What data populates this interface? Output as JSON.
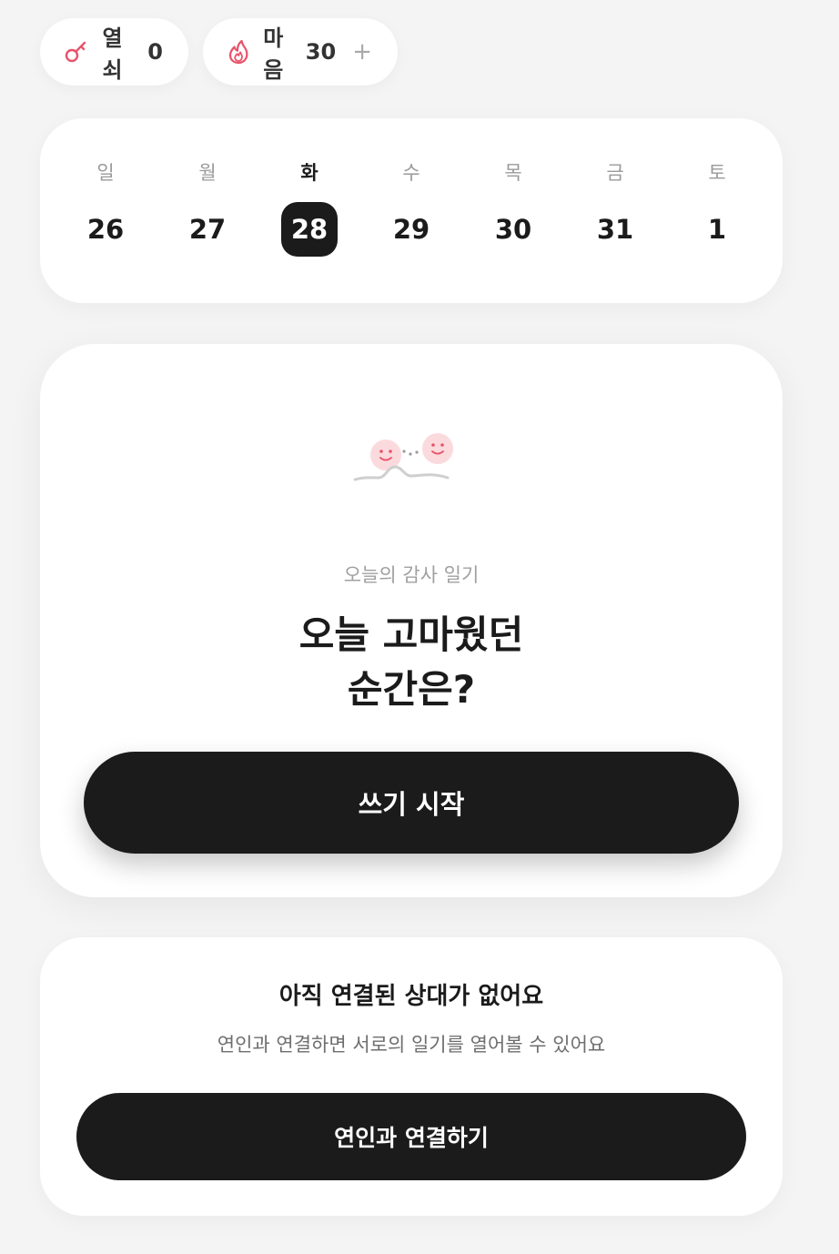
{
  "chips": {
    "key": {
      "icon": "key-icon",
      "label": "열쇠",
      "count": "0"
    },
    "heart": {
      "icon": "flame-icon",
      "label": "마음",
      "count": "30",
      "add": "+"
    }
  },
  "week": {
    "days": [
      {
        "dow": "일",
        "date": "26"
      },
      {
        "dow": "월",
        "date": "27"
      },
      {
        "dow": "화",
        "date": "28"
      },
      {
        "dow": "수",
        "date": "29"
      },
      {
        "dow": "목",
        "date": "30"
      },
      {
        "dow": "금",
        "date": "31"
      },
      {
        "dow": "토",
        "date": "1"
      }
    ],
    "selected_date": "28"
  },
  "gratitude": {
    "illustration": "couple-faces-illustration",
    "subtitle": "오늘의 감사 일기",
    "question_line1": "오늘 고마웠던",
    "question_line2": "순간은?",
    "cta": "쓰기 시작"
  },
  "connect": {
    "title": "아직 연결된 상대가 없어요",
    "description": "연인과 연결하면 서로의 일기를 열어볼 수 있어요",
    "cta": "연인과 연결하기"
  },
  "colors": {
    "background": "#f4f4f4",
    "card": "#ffffff",
    "primary": "#1b1b1b",
    "accent": "#e9536a",
    "face": "#fbdadd"
  }
}
